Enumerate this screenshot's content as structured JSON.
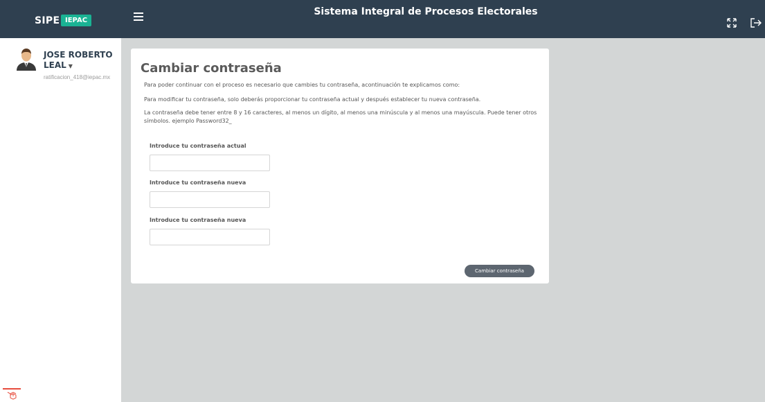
{
  "header": {
    "brand": "SIPE",
    "brand_badge": "IEPAC",
    "app_title": "Sistema Integral de Procesos Electorales",
    "icons": [
      "menu-icon",
      "fullscreen-icon",
      "logout-icon"
    ]
  },
  "sidebar": {
    "user_name": "JOSE ROBERTO LEAL",
    "user_email": "ratificacion_418@iepac.mx"
  },
  "card": {
    "title": "Cambiar contraseña",
    "paragraphs": [
      "Para poder continuar con el proceso es necesario que cambies tu contraseña, acontinuación te explicamos como:",
      "Para modificar tu contraseña, solo deberás proporcionar tu contraseña actual y después establecer tu nueva contraseña.",
      "La contraseña debe tener entre 8 y 16 caracteres, al menos un dígito, al menos una minúscula y al menos una mayúscula. Puede tener otros símbolos. ejemplo Password32_"
    ],
    "fields": [
      {
        "label": "Introduce tu contraseña actual",
        "value": ""
      },
      {
        "label": "Introduce tu contraseña nueva",
        "value": ""
      },
      {
        "label": "Introduce tu contraseña nueva",
        "value": ""
      }
    ],
    "submit_label": "Cambiar contraseña"
  },
  "colors": {
    "topbar": "#2f4050",
    "accent": "#1ab394",
    "background": "#d3d6d6",
    "button": "#5d6670"
  }
}
